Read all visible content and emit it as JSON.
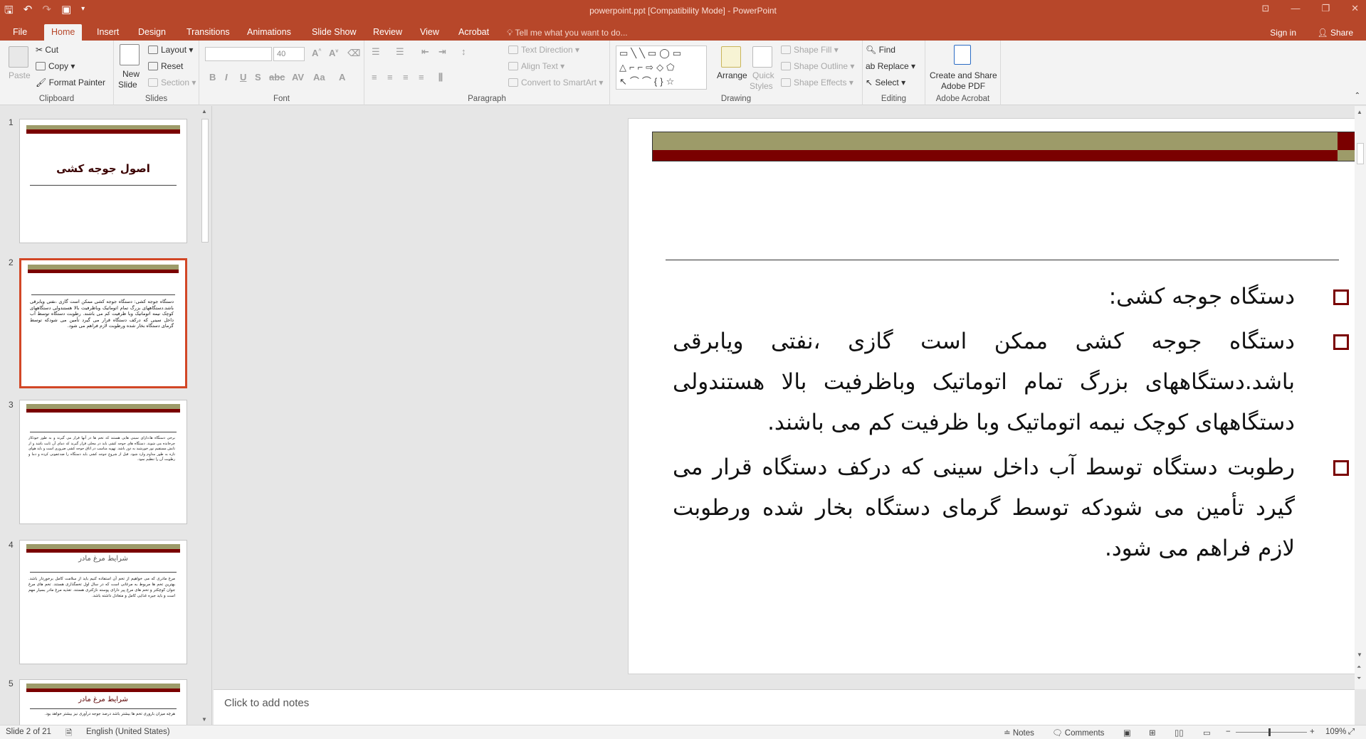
{
  "window": {
    "title": "powerpoint.ppt [Compatibility Mode] - PowerPoint",
    "colors": {
      "accent": "#b7472a",
      "slide_olive": "#9d9b69",
      "slide_dark": "#7a0000"
    }
  },
  "tabs": [
    "File",
    "Home",
    "Insert",
    "Design",
    "Transitions",
    "Animations",
    "Slide Show",
    "Review",
    "View",
    "Acrobat"
  ],
  "active_tab": "Home",
  "tell_me": "Tell me what you want to do...",
  "signin": "Sign in",
  "share": "Share",
  "ribbon": {
    "clipboard": {
      "label": "Clipboard",
      "paste": "Paste",
      "cut": "Cut",
      "copy": "Copy",
      "format_painter": "Format Painter"
    },
    "slides": {
      "label": "Slides",
      "new_slide_1": "New",
      "new_slide_2": "Slide",
      "layout": "Layout",
      "reset": "Reset",
      "section": "Section"
    },
    "font": {
      "label": "Font",
      "size": "40"
    },
    "paragraph": {
      "label": "Paragraph",
      "text_direction": "Text Direction",
      "align_text": "Align Text",
      "convert_smartart": "Convert to SmartArt"
    },
    "drawing": {
      "label": "Drawing",
      "arrange": "Arrange",
      "quick_styles_1": "Quick",
      "quick_styles_2": "Styles",
      "shape_fill": "Shape Fill",
      "shape_outline": "Shape Outline",
      "shape_effects": "Shape Effects"
    },
    "editing": {
      "label": "Editing",
      "find": "Find",
      "replace": "Replace",
      "select": "Select"
    },
    "acrobat": {
      "label": "Adobe Acrobat",
      "create_1": "Create and Share",
      "create_2": "Adobe PDF"
    }
  },
  "thumbnails": {
    "numbers": [
      "1",
      "2",
      "3",
      "4",
      "5"
    ],
    "t1_title": "اصول جوجه کشی",
    "t2_text": "دستگاه جوجه کشی: دستگاه جوجه کشی ممکن است گازی ،نفتی ویابرقی باشد.دستگاههای بزرگ تمام اتوماتیک وباظرفیت بالا هستندولی دستگاههای کوچک نیمه اتوماتیک وبا ظرفیت کم می باشند. رطوبت دستگاه توسط آب داخل سینی که درکف دستگاه قرار می گیرد تأمین می شودکه توسط گرمای دستگاه بخار شده ورطوبت لازم فراهم می شود.",
    "t3_text": "برخی دستگاه ها،دارای سینی هایی هستند که تخم ها در آنها قرار می گیرند و به طور خودکار چرخانده می شوند. دستگاه های جوجه کشی باید در محلی قرار گیرند که دمای آن ثابت باشد و از تابش مستقیم نور خورشید به دور باشد. تهویه مناسب در اتاق جوجه کشی ضروری است و باید هوای تازه به طور مداوم وارد شود. قبل از شروع جوجه کشی باید دستگاه را ضدعفونی کرده و دما و رطوبت آن را تنظیم نمود.",
    "t4_title": "شرایط مرغ مادر",
    "t4_text": "مرغ مادری که می خواهیم از تخم آن استفاده کنیم باید از سلامت کامل برخوردار باشد. بهترین تخم ها مربوط به مرغانی است که در سال اول تخمگذاری هستند. تخم های مرغ جوان کوچکتر و تخم های مرغ پیر دارای پوسته نازکتری هستند. تغذیه مرغ مادر بسیار مهم است و باید جیره غذایی کامل و متعادل داشته باشد.",
    "t5_title": "شرایط مرغ مادر",
    "t5_text": "هرچه میزان باروری تخم ها بیشتر باشد درصد جوجه درآوری نیز بیشتر خواهد بود."
  },
  "slide": {
    "paragraphs": [
      "دستگاه جوجه کشی:",
      "دستگاه جوجه کشی ممکن است گازی ،نفتی ویابرقی باشد.دستگاههای بزرگ تمام اتوماتیک وباظرفیت بالا هستندولی دستگاههای کوچک نیمه اتوماتیک وبا ظرفیت کم می باشند.",
      "رطوبت دستگاه توسط آب داخل سینی که درکف دستگاه قرار می گیرد تأمین می شودکه توسط گرمای دستگاه بخار شده ورطوبت لازم فراهم می شود."
    ]
  },
  "notes_placeholder": "Click to add notes",
  "status": {
    "slide_info": "Slide 2 of 21",
    "language": "English (United States)",
    "notes": "Notes",
    "comments": "Comments",
    "zoom": "109%"
  }
}
